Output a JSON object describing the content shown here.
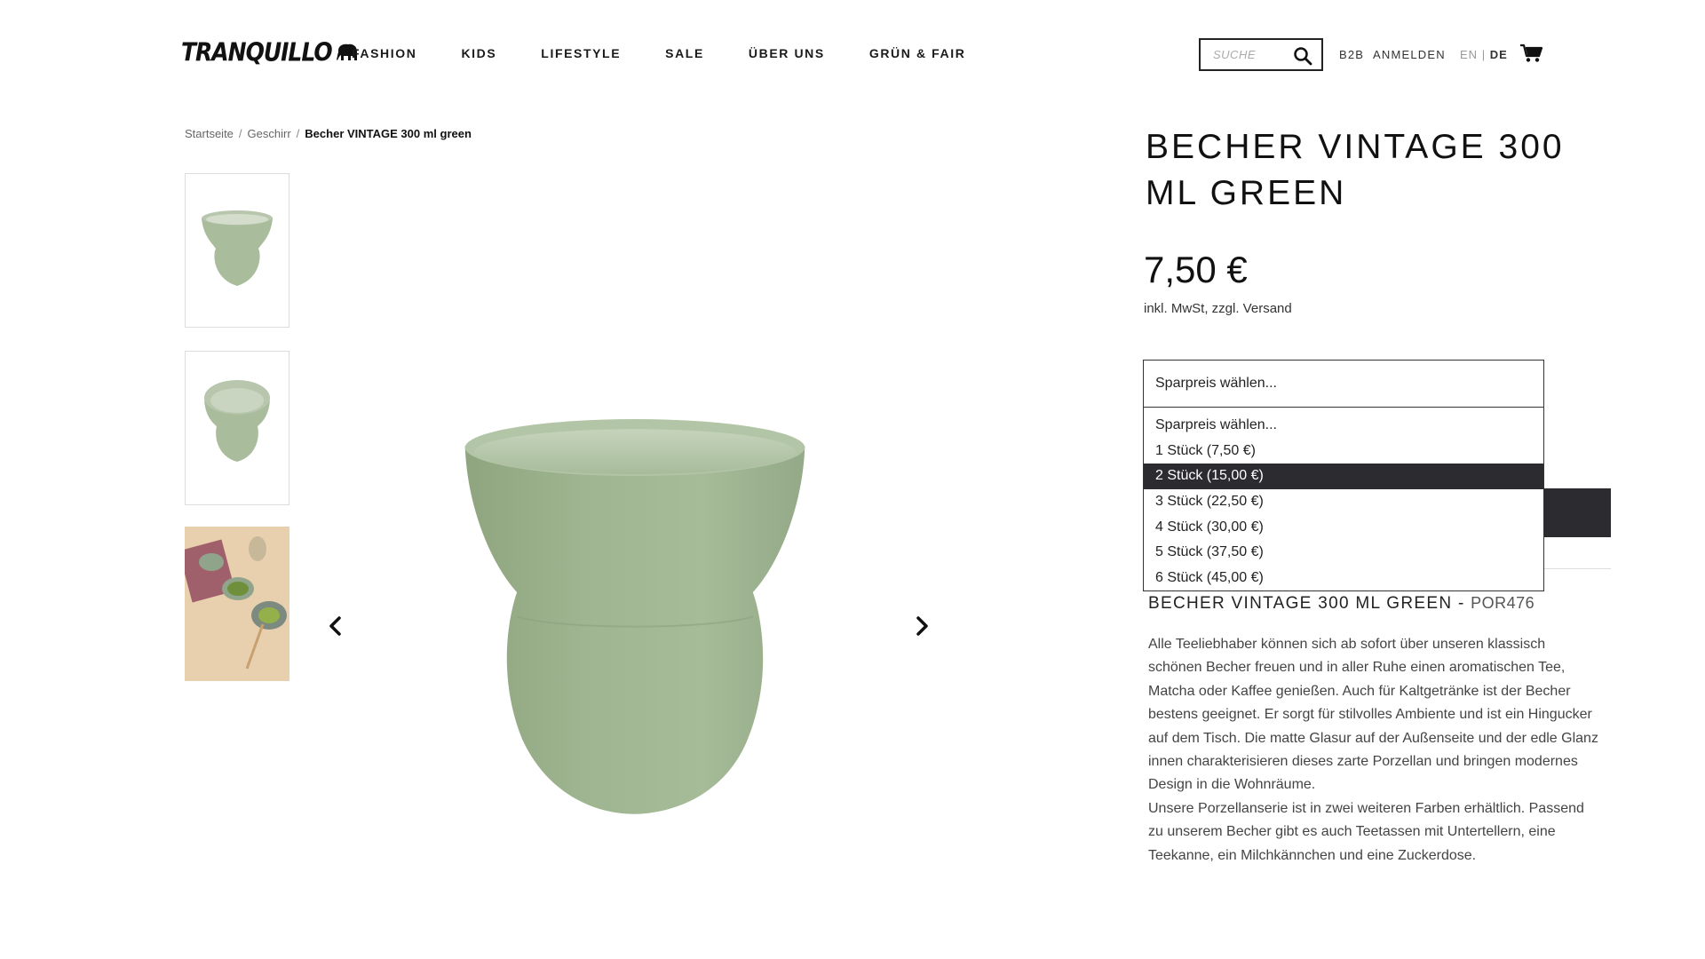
{
  "header": {
    "logo_text": "TRANQUILLO",
    "nav": [
      "FASHION",
      "KIDS",
      "LIFESTYLE",
      "SALE",
      "ÜBER UNS",
      "GRÜN & FAIR"
    ],
    "search_placeholder": "SUCHE",
    "b2b_label": "B2B",
    "login_label": "ANMELDEN",
    "lang_en": "EN",
    "lang_sep": "|",
    "lang_de": "DE"
  },
  "breadcrumb": {
    "home": "Startseite",
    "category": "Geschirr",
    "current": "Becher VINTAGE 300 ml green",
    "sep": "/"
  },
  "product": {
    "title": "BECHER VINTAGE 300 ML GREEN",
    "price": "7,50 €",
    "tax_note": "inkl. MwSt, zzgl. Versand",
    "sku_title": "BECHER VINTAGE 300 ML GREEN",
    "sku_sep": " - ",
    "sku": "POR476",
    "description": "Alle Teeliebhaber können sich ab sofort über unseren klassisch schönen Becher freuen und in aller Ruhe einen aromatischen Tee, Matcha oder Kaffee genießen. Auch für Kaltgetränke ist der Becher bestens geeignet. Er sorgt für stilvolles Ambiente und ist ein Hingucker auf dem Tisch. Die matte Glasur auf der Außenseite und der edle Glanz innen charakterisieren dieses zarte Porzellan und bringen modernes Design in die Wohnräume.",
    "description2": "Unsere Porzellanserie ist in zwei weiteren Farben erhältlich. Passend zu unserem Becher gibt es auch Teetassen mit Untertellern, eine Teekanne, ein Milchkännchen und eine Zuckerdose."
  },
  "select": {
    "current_value": "Sparpreis wählen...",
    "options": [
      "Sparpreis wählen...",
      "1 Stück (7,50 €)",
      "2 Stück (15,00 €)",
      "3 Stück (22,50 €)",
      "4 Stück (30,00 €)",
      "5 Stück (37,50 €)",
      "6 Stück (45,00 €)"
    ],
    "highlighted_index": 2
  },
  "colors": {
    "cup_green": "#9bb28f",
    "dark_button": "#2b2b30"
  }
}
